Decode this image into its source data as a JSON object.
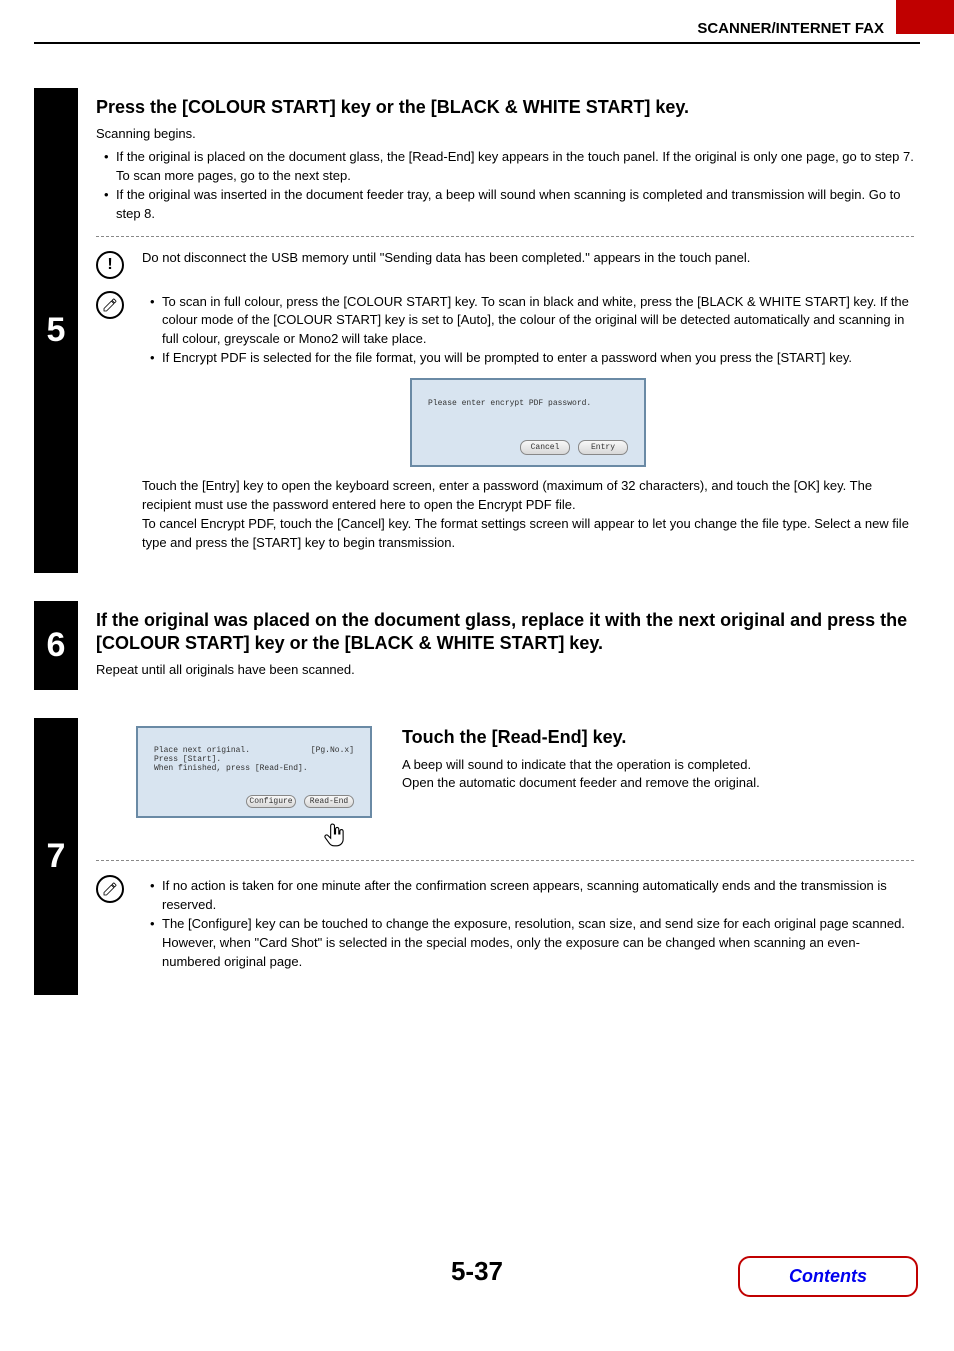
{
  "header": {
    "section": "SCANNER/INTERNET FAX"
  },
  "step5": {
    "number": "5",
    "title": "Press the [COLOUR START] key or the [BLACK & WHITE START] key.",
    "intro": "Scanning begins.",
    "bullets": [
      "If the original is placed on the document glass, the [Read-End] key appears in the touch panel. If the original is only one page, go to step 7. To scan more pages, go to the next step.",
      "If the original was inserted in the document feeder tray, a beep will sound when scanning is completed and transmission will begin. Go to step 8."
    ],
    "caution": "Do not disconnect the USB memory until \"Sending data has been completed.\" appears in the touch panel.",
    "note_bullets": [
      "To scan in full colour, press the [COLOUR START] key. To scan in black and white, press the [BLACK & WHITE START] key. If the colour mode of the [COLOUR START] key is set to [Auto], the colour of the original will be detected automatically and scanning in full colour, greyscale or Mono2 will take place.",
      "If Encrypt PDF is selected for the file format, you will be prompted to enter a password when you press the [START] key."
    ],
    "panel": {
      "message": "Please enter encrypt PDF password.",
      "cancel": "Cancel",
      "entry": "Entry"
    },
    "after_panel": "Touch the [Entry] key to open the keyboard screen, enter a password (maximum of 32 characters), and touch the [OK] key. The recipient must use the password entered here to open the Encrypt PDF file.\nTo cancel Encrypt PDF, touch the [Cancel] key. The format settings screen will appear to let you change the file type. Select a new file type and press the [START] key to begin transmission."
  },
  "step6": {
    "number": "6",
    "title": "If the original was placed on the document glass, replace it with the next original and press the [COLOUR START] key or the [BLACK & WHITE START] key.",
    "body": "Repeat until all originals have been scanned."
  },
  "step7": {
    "number": "7",
    "panel": {
      "line1a": "Place next original.",
      "line1b": "[Pg.No.x]",
      "line2": "Press [Start].",
      "line3": "When finished, press [Read-End].",
      "configure": "Configure",
      "readend": "Read-End"
    },
    "title": "Touch the [Read-End] key.",
    "body1": "A beep will sound to indicate that the operation is completed.",
    "body2": "Open the automatic document feeder and remove the original.",
    "note_bullets": [
      "If no action is taken for one minute after the confirmation screen appears, scanning automatically ends and the transmission is reserved.",
      "The [Configure] key can be touched to change the exposure, resolution, scan size, and send size for each original page scanned. However, when \"Card Shot\" is selected in the special modes, only the exposure can be changed when scanning an even-numbered original page."
    ]
  },
  "footer": {
    "page": "5-37",
    "contents": "Contents"
  }
}
